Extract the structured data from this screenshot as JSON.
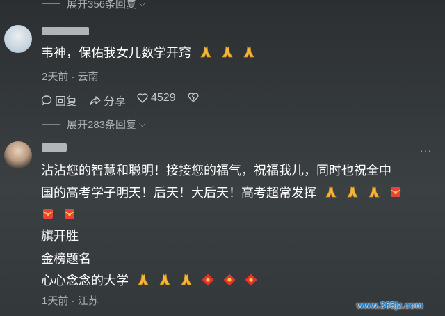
{
  "thread1": {
    "expand_text": "展开356条回复",
    "comment": "韦神，保佑我女儿数学开窍",
    "meta": "2天前 · 云南",
    "reply_label": "回复",
    "share_label": "分享",
    "like_count": "4529"
  },
  "thread2": {
    "expand_text": "展开283条回复",
    "line1": "沾沾您的智慧和聪明！接接您的福气，祝福我儿，同时也祝全中",
    "line2": "国的高考学子明天！后天！大后天！高考超常发挥",
    "line4": "旗开胜",
    "line5": "金榜题名",
    "line6": "心心念念的大学",
    "meta": "1天前 · 江苏"
  },
  "watermark": "www.365jz.com",
  "icons": [
    "chevron-down-icon",
    "reply-icon",
    "share-icon",
    "heart-icon",
    "dislike-icon",
    "pray-emoji",
    "red-envelope-emoji",
    "fu-emoji",
    "more-icon"
  ],
  "colors": {
    "background": "#33383b",
    "text": "#ffffff",
    "muted": "#a9b0b3",
    "watermark": "#1b7cc9"
  }
}
